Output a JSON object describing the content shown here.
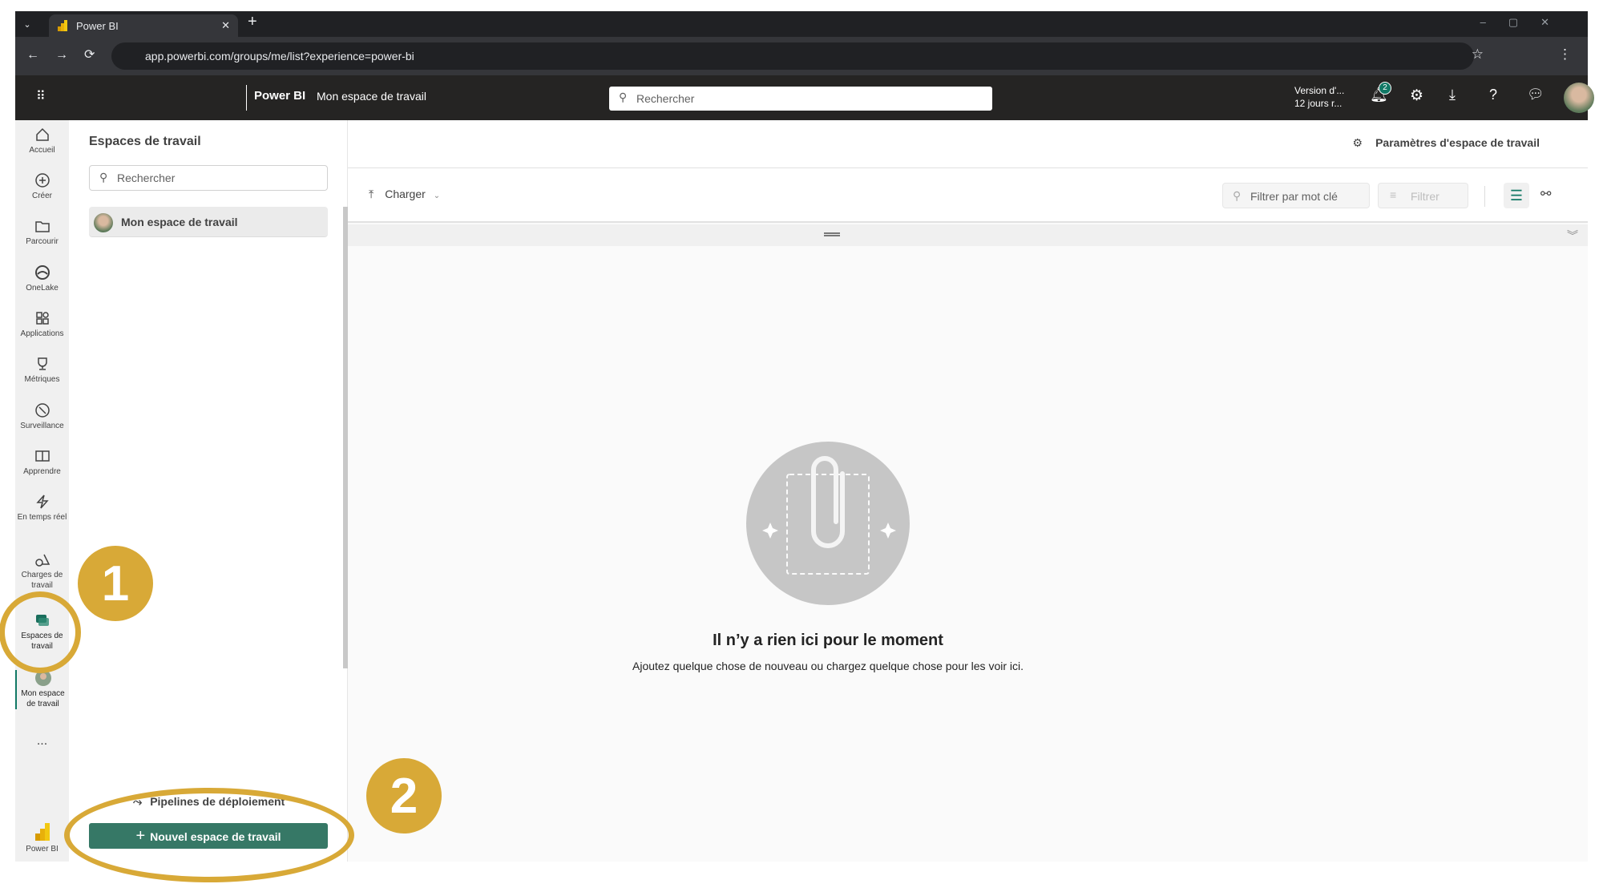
{
  "browser": {
    "tab_title": "Power BI",
    "url": "app.powerbi.com/groups/me/list?experience=power-bi"
  },
  "header": {
    "app_name": "Power BI",
    "breadcrumb": "Mon espace de travail",
    "search_placeholder": "Rechercher",
    "trial_line1": "Version d'...",
    "trial_line2": "12 jours r...",
    "notification_count": "2"
  },
  "rail": {
    "items": [
      {
        "label": "Accueil",
        "icon": "home-icon"
      },
      {
        "label": "Créer",
        "icon": "plus-circle-icon"
      },
      {
        "label": "Parcourir",
        "icon": "folder-icon"
      },
      {
        "label": "OneLake",
        "icon": "onelake-icon"
      },
      {
        "label": "Applications",
        "icon": "apps-icon"
      },
      {
        "label": "Métriques",
        "icon": "trophy-icon"
      },
      {
        "label": "Surveillance",
        "icon": "monitor-icon"
      },
      {
        "label": "Apprendre",
        "icon": "book-icon"
      },
      {
        "label": "En temps réel",
        "icon": "lightning-icon"
      },
      {
        "label": "Charges de travail",
        "icon": "shapes-icon"
      },
      {
        "label": "Espaces de travail",
        "icon": "workspaces-icon"
      },
      {
        "label": "Mon espace de travail",
        "icon": "avatar"
      }
    ],
    "more": "...",
    "brand": "Power BI"
  },
  "panel": {
    "title": "Espaces de travail",
    "search_placeholder": "Rechercher",
    "workspaces": [
      "Mon espace de travail"
    ],
    "pipelines": "Pipelines de déploiement",
    "new_button": "Nouvel espace de travail"
  },
  "main": {
    "settings": "Paramètres d'espace de travail",
    "upload": "Charger",
    "filter_placeholder": "Filtrer par mot clé",
    "filter": "Filtrer",
    "empty_title": "Il n’y a rien ici pour le moment",
    "empty_subtitle": "Ajoutez quelque chose de nouveau ou chargez quelque chose pour les voir ici."
  },
  "annotations": {
    "step1": "1",
    "step2": "2"
  },
  "colors": {
    "accent": "#117865",
    "annotation": "#d8a937",
    "header": "#252423"
  }
}
